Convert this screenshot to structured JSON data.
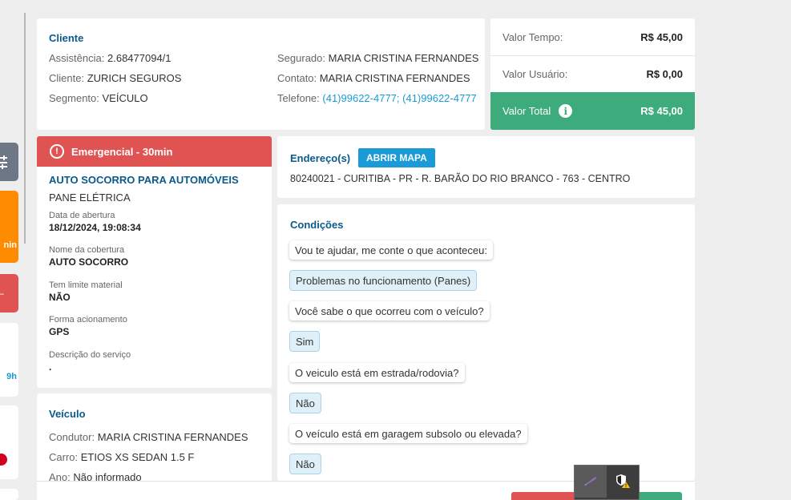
{
  "cliente": {
    "title": "Cliente",
    "assistencia_label": "Assistência:",
    "assistencia_value": "2.68477094/1",
    "cliente_label": "Cliente:",
    "cliente_value": "ZURICH SEGUROS",
    "segmento_label": "Segmento:",
    "segmento_value": "VEÍCULO",
    "segurado_label": "Segurado:",
    "segurado_value": "MARIA CRISTINA FERNANDES",
    "contato_label": "Contato:",
    "contato_value": "MARIA CRISTINA FERNANDES",
    "telefone_label": "Telefone:",
    "telefone_value": "(41)99622-4777; (41)99622-4777"
  },
  "valores": {
    "tempo_label": "Valor Tempo:",
    "tempo_value": "R$ 45,00",
    "usuario_label": "Valor Usuário:",
    "usuario_value": "R$ 0,00",
    "total_label": "Valor Total",
    "total_value": "R$ 45,00",
    "total_color": "#3dab7b"
  },
  "servico": {
    "priority": "Emergencial - 30min",
    "priority_color": "#e05353",
    "name": "AUTO SOCORRO PARA AUTOMÓVEIS",
    "subtype": "PANE ELÉTRICA",
    "fields": [
      {
        "label": "Data de abertura",
        "value": "18/12/2024, 19:08:34"
      },
      {
        "label": "Nome da cobertura",
        "value": "AUTO SOCORRO"
      },
      {
        "label": "Tem limite material",
        "value": "NÃO"
      },
      {
        "label": "Forma acionamento",
        "value": "GPS"
      },
      {
        "label": "Descrição do serviço",
        "value": "."
      }
    ]
  },
  "veiculo": {
    "title": "Veículo",
    "condutor_label": "Condutor:",
    "condutor_value": "MARIA CRISTINA FERNANDES",
    "carro_label": "Carro:",
    "carro_value": "ETIOS XS SEDAN 1.5 F",
    "ano_label": "Ano:",
    "ano_value": "Não informado"
  },
  "endereco": {
    "title": "Endereço(s)",
    "map_button": "ABRIR MAPA",
    "address": "80240021 - CURITIBA - PR - R. BARÃO DO RIO BRANCO - 763 - CENTRO"
  },
  "condicoes": {
    "title": "Condições",
    "items": [
      {
        "type": "q",
        "text": "Vou te ajudar, me conte o que aconteceu:"
      },
      {
        "type": "a",
        "text": "Problemas no funcionamento (Panes)"
      },
      {
        "type": "q",
        "text": "Você sabe o que ocorreu com o veículo?"
      },
      {
        "type": "a",
        "text": "Sim"
      },
      {
        "type": "q",
        "text": "O veiculo está em estrada/rodovia?"
      },
      {
        "type": "a",
        "text": "Não"
      },
      {
        "type": "q",
        "text": "O veículo está em garagem subsolo ou elevada?"
      },
      {
        "type": "a",
        "text": "Não"
      }
    ]
  },
  "left_tabs": {
    "orange_text": "nin",
    "blue_text": "9h",
    "badge_color": "#d0021b"
  },
  "icons": {
    "sliders": "sliders-icon",
    "alert": "alert-circle-icon",
    "info": "info-icon",
    "pen": "pen-icon",
    "shield": "shield-warning-icon"
  }
}
